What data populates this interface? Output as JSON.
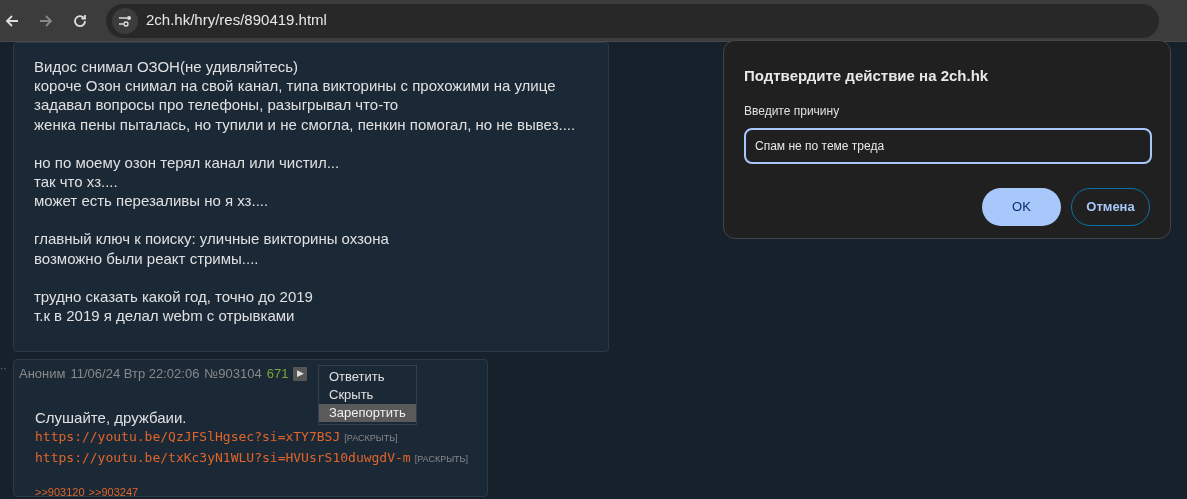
{
  "browser": {
    "url": "2ch.hk/hry/res/890419.html"
  },
  "posts": [
    {
      "paragraphs": [
        [
          "Видос снимал ОЗОН(не удивляйтесь)",
          "короче Озон снимал на свой канал, типа викторины с прохожими на улице",
          "задавал вопросы про телефоны, разыгрывал что-то",
          "женка пены пыталась, но тупили и не смогла, пенкин помогал, но не вывез...."
        ],
        [
          "но по моему озон терял канал или чистил...",
          "так что хз....",
          "может есть перезаливы но я хз...."
        ],
        [
          "главный ключ к поиску: уличные викторины охзона",
          "возможно были реакт стримы...."
        ],
        [
          "трудно сказать какой год, точно до 2019",
          "т.к в 2019 я делал webm с отрывками"
        ]
      ]
    },
    {
      "marker": "··",
      "author": "Аноним",
      "date": "11/06/24 Втр 22:02:06",
      "number": "№903104",
      "count": "671",
      "arrow": "▶",
      "menu": [
        {
          "label": "Ответить",
          "selected": false
        },
        {
          "label": "Скрыть",
          "selected": false
        },
        {
          "label": "Зарепортить",
          "selected": true
        }
      ],
      "text": "Слушайте, дружбаии.",
      "links": [
        {
          "url": "https://youtu.be/QzJFSlHgsec?si=xTY7BSJ",
          "expand": "[РАСКРЫТЬ]"
        },
        {
          "url": "https://youtu.be/txKc3yN1WLU?si=HVUsrS10duwgdV-m",
          "expand": "[РАСКРЫТЬ]"
        }
      ],
      "replies": [
        ">>903120",
        ">>903247"
      ]
    }
  ],
  "dialog": {
    "title": "Подтвердите действие на 2ch.hk",
    "label": "Введите причину",
    "value": "Спам не по теме треда",
    "buttons": [
      {
        "label": "OK",
        "kind": "primary"
      },
      {
        "label": "Отмена",
        "kind": "secondary"
      }
    ]
  }
}
